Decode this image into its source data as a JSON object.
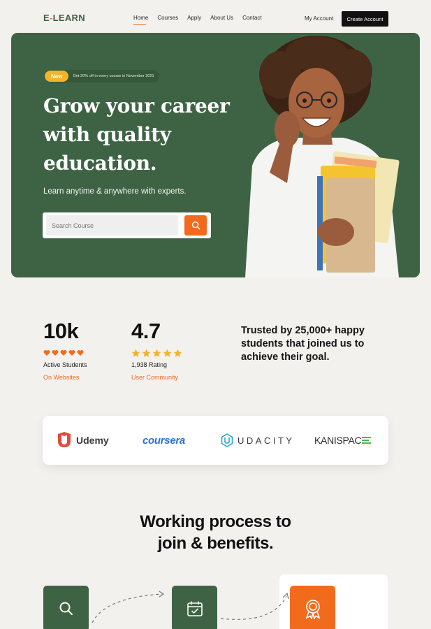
{
  "brand": {
    "logo": "E-LEARN"
  },
  "nav": {
    "items": [
      {
        "label": "Home",
        "active": true
      },
      {
        "label": "Courses"
      },
      {
        "label": "Apply"
      },
      {
        "label": "About Us"
      },
      {
        "label": "Contact"
      }
    ],
    "my_account": "My Account",
    "create_account": "Create Account"
  },
  "hero": {
    "badge": "New",
    "promo": "Get 20% off in every course in November 2021",
    "headline": [
      "Grow your career",
      "with quality",
      "education."
    ],
    "subtitle": "Learn anytime & anywhere with experts.",
    "search_placeholder": "Search Course"
  },
  "stats": [
    {
      "value": "10k",
      "label": "Active Students",
      "link": "On Websites",
      "stars": 5,
      "star_color": "#f26b1d"
    },
    {
      "value": "4.7",
      "label": "1,938 Rating",
      "link": "User Community",
      "stars": 5,
      "star_color": "#f4b32c"
    }
  ],
  "trust_text": "Trusted by 25,000+ happy students that joined us to achieve their goal.",
  "partners": [
    {
      "name": "Udemy",
      "icon": "udemy-logo"
    },
    {
      "name": "coursera",
      "icon": "coursera-logo"
    },
    {
      "name": "UDACITY",
      "icon": "udacity-logo"
    },
    {
      "name": "KANISPACE",
      "icon": "kanispace-logo"
    }
  ],
  "process": {
    "title": [
      "Working process to",
      "join & benefits."
    ],
    "steps": [
      {
        "icon": "search-icon"
      },
      {
        "icon": "calendar-check-icon"
      },
      {
        "icon": "award-icon"
      }
    ]
  },
  "colors": {
    "brand_green": "#3e6344",
    "accent_orange": "#f26b1d",
    "star_yellow": "#f4b32c"
  }
}
